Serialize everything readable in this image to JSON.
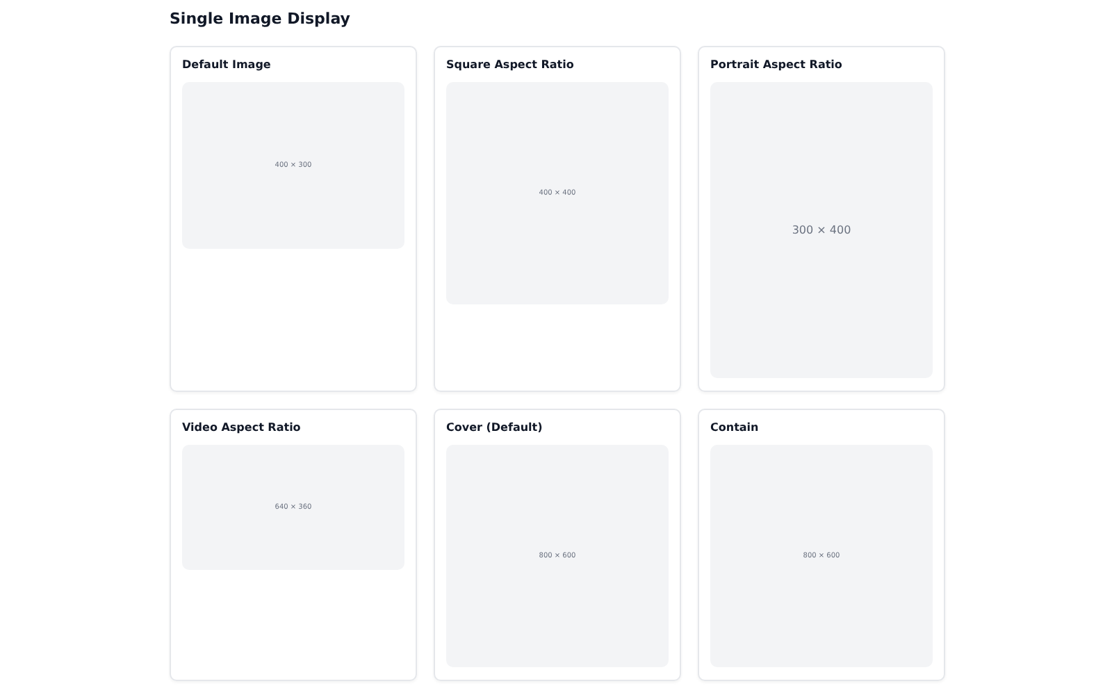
{
  "heading": "Single Image Display",
  "cards": [
    {
      "title": "Default Image",
      "image": {
        "kind": "landscape",
        "label": "400 × 300"
      }
    },
    {
      "title": "Square Aspect Ratio",
      "image": {
        "kind": "square",
        "label": "400 × 400"
      }
    },
    {
      "title": "Portrait Aspect Ratio",
      "image": {
        "kind": "portrait",
        "label": "300 × 400"
      }
    },
    {
      "title": "Video Aspect Ratio",
      "image": {
        "kind": "video",
        "label": "640 × 360"
      }
    },
    {
      "title": "Cover (Default)",
      "image": {
        "kind": "cover",
        "label": "800 × 600"
      }
    },
    {
      "title": "Contain",
      "image": {
        "kind": "contain",
        "label": "800 × 600"
      }
    }
  ]
}
